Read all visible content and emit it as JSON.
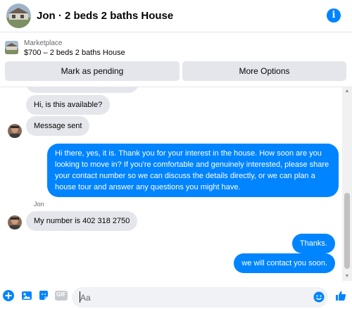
{
  "header": {
    "title": "Jon · 2 beds 2 baths House"
  },
  "marketplace": {
    "label": "Marketplace",
    "listing": "$700 – 2 beds 2 baths House",
    "pending_button": "Mark as pending",
    "more_button": "More Options"
  },
  "messages": {
    "m1": "Hi, is this available?",
    "m2": "Message sent",
    "m3": "Hi there, yes, it is. Thank you for your interest in the house. How soon are you looking to move in? If you're comfortable and genuinely interested, please share your contact number so we can discuss the details directly, or we can plan a house tour and answer any questions you might have.",
    "sender_name": "Jon",
    "m4": "My number is 402 318 2750",
    "m5": "Thanks.",
    "m6": "we will contact you soon."
  },
  "composer": {
    "placeholder": "Aa",
    "gif_label": "GIF"
  },
  "colors": {
    "accent": "#0084ff",
    "incoming_bubble": "#e4e6eb",
    "button_bg": "#e4e6eb"
  },
  "icons": [
    "info-icon",
    "plus-icon",
    "image-icon",
    "sticker-icon",
    "gif-icon",
    "emoji-icon",
    "thumbs-up-icon"
  ]
}
